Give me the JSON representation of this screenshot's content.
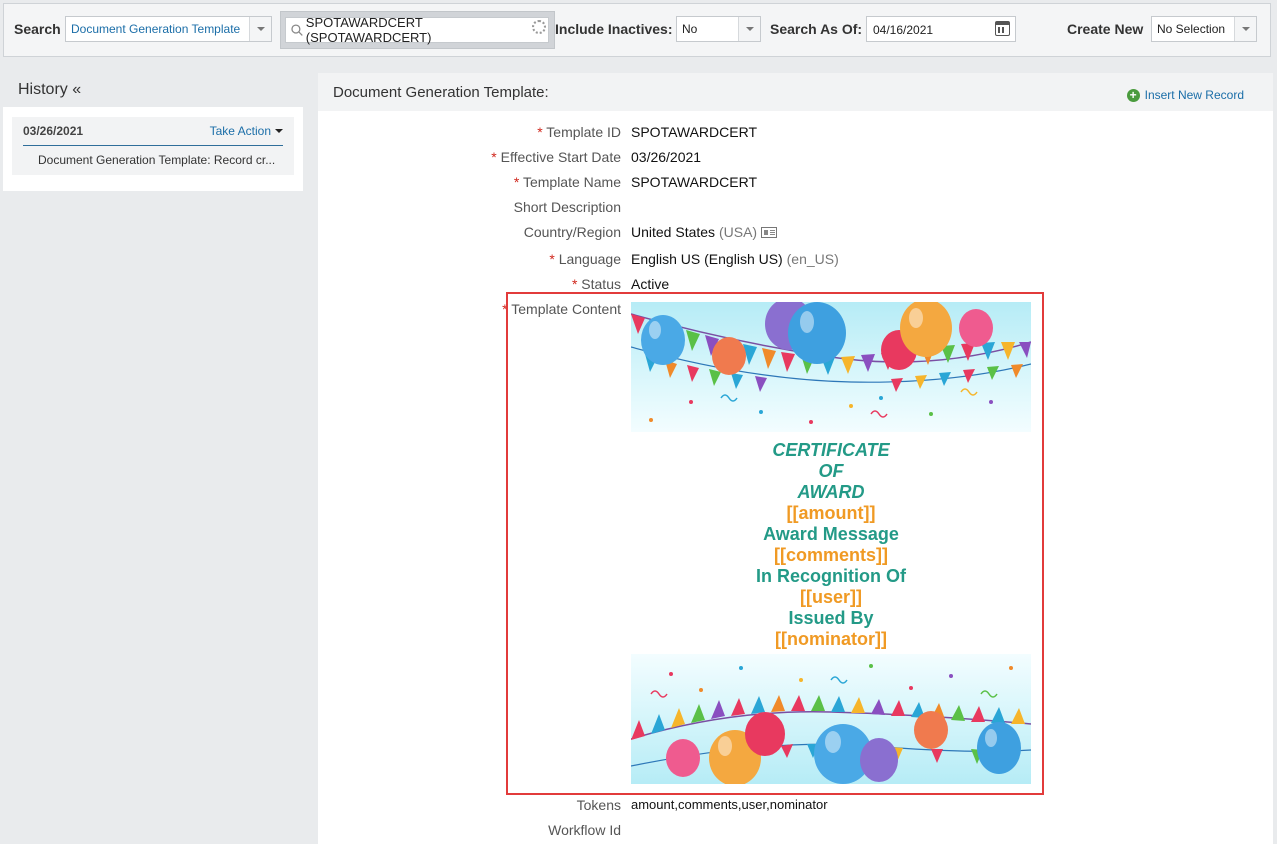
{
  "topbar": {
    "search_label": "Search",
    "search_type": "Document Generation Template",
    "search_value": "SPOTAWARDCERT (SPOTAWARDCERT)",
    "include_inactives_label": "Include Inactives:",
    "include_inactives_value": "No",
    "search_as_of_label": "Search As Of:",
    "search_as_of_value": "04/16/2021",
    "create_new_label": "Create New",
    "create_new_value": "No Selection"
  },
  "history": {
    "title": "History «",
    "entry_date": "03/26/2021",
    "take_action": "Take Action",
    "entry_desc": "Document Generation Template: Record cr..."
  },
  "main": {
    "header": "Document Generation Template:",
    "insert_new": "Insert New Record",
    "fields": {
      "template_id": {
        "label": "Template ID",
        "value": "SPOTAWARDCERT"
      },
      "effective_start_date": {
        "label": "Effective Start Date",
        "value": "03/26/2021"
      },
      "template_name": {
        "label": "Template Name",
        "value": "SPOTAWARDCERT"
      },
      "short_description": {
        "label": "Short Description",
        "value": ""
      },
      "country_region": {
        "label": "Country/Region",
        "value": "United States",
        "code": "(USA)"
      },
      "language": {
        "label": "Language",
        "value": "English US (English US)",
        "code": "(en_US)"
      },
      "status": {
        "label": "Status",
        "value": "Active"
      },
      "template_content": {
        "label": "Template Content"
      },
      "tokens": {
        "label": "Tokens",
        "value": "amount,comments,user,nominator"
      },
      "workflow_id": {
        "label": "Workflow Id",
        "value": ""
      }
    },
    "certificate": {
      "line1": "CERTIFICATE",
      "line2": "OF",
      "line3": "AWARD",
      "amount": "[[amount]]",
      "award_message": "Award Message",
      "comments": "[[comments]]",
      "recognition": "In Recognition Of",
      "user": "[[user]]",
      "issued_by": "Issued By",
      "nominator": "[[nominator]]"
    },
    "required_marker": "*"
  },
  "colors": {
    "accent_green": "#239a87",
    "token_orange": "#f09a24",
    "link_blue": "#1b6ea8",
    "required_red": "#d0271d",
    "highlight_red": "#e23b3b"
  }
}
